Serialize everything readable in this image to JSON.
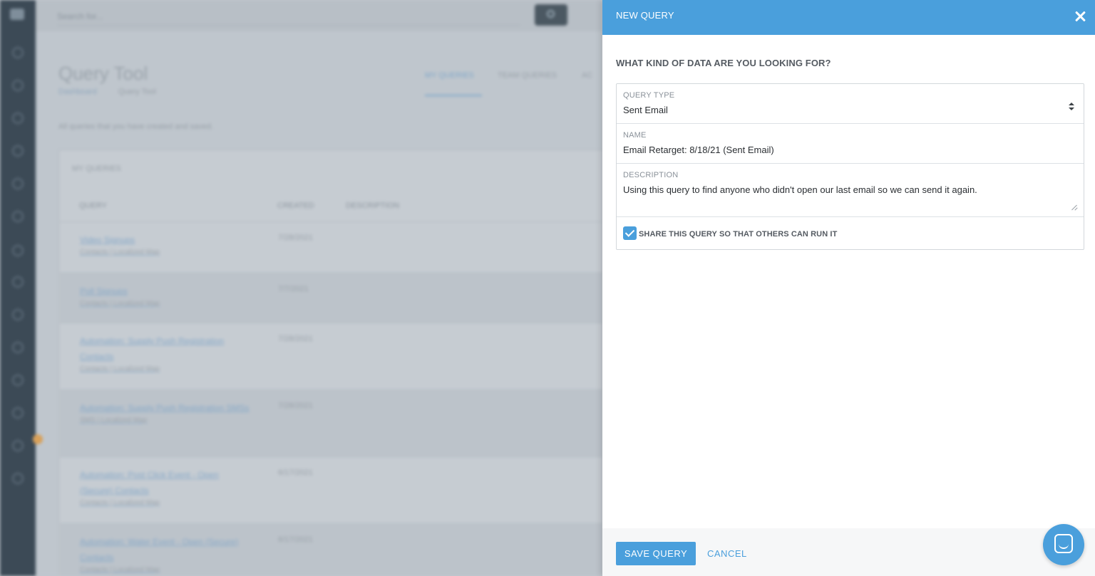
{
  "background": {
    "search_placeholder": "Search for...",
    "page_title": "Query Tool",
    "breadcrumb": [
      "Dashboard",
      "Query Tool"
    ],
    "tabs": [
      "MY QUERIES",
      "TEAM QUERIES",
      "AC"
    ],
    "subtitle": "All queries that you have created and saved.",
    "card_title": "MY QUERIES",
    "columns": [
      "QUERY",
      "CREATED",
      "DESCRIPTION"
    ],
    "rows": [
      {
        "name": "Video Signups",
        "meta": "Contacts | Localized Map",
        "date": "7/28/2021"
      },
      {
        "name": "Poll Signups",
        "meta": "Contacts | Localized Map",
        "date": "7/7/2021"
      },
      {
        "name": "Automation: Supply Push Registration Contacts",
        "meta": "Contacts | Localized Map",
        "date": "7/28/2021"
      },
      {
        "name": "Automation: Supply Push Registration SMSs",
        "meta": "SMS | Localized Map",
        "date": "7/28/2021"
      },
      {
        "name": "Automation: Post Click Event - Open (Secure) Contacts",
        "meta": "Contacts | Localized Map",
        "date": "6/17/2021"
      },
      {
        "name": "Automation: Water Event - Open (Secure) Contacts",
        "meta": "Contacts | Localized Map",
        "date": "6/17/2021"
      }
    ]
  },
  "modal": {
    "title": "NEW QUERY",
    "question": "WHAT KIND OF DATA ARE YOU LOOKING FOR?",
    "query_type": {
      "label": "QUERY TYPE",
      "value": "Sent Email"
    },
    "name": {
      "label": "NAME",
      "value": "Email Retarget: 8/18/21 (Sent Email)"
    },
    "description": {
      "label": "DESCRIPTION",
      "value": "Using this query to find anyone who didn't open our last email so we can send it again."
    },
    "share": {
      "label": "SHARE THIS QUERY SO THAT OTHERS CAN RUN IT",
      "checked": true
    },
    "save_label": "SAVE QUERY",
    "cancel_label": "CANCEL"
  },
  "colors": {
    "accent": "#4a9fdc",
    "sidebar": "#3c4a56"
  },
  "icons": [
    "close-icon",
    "select-arrows-icon",
    "checkbox-check-icon",
    "chat-icon",
    "search-icon"
  ]
}
